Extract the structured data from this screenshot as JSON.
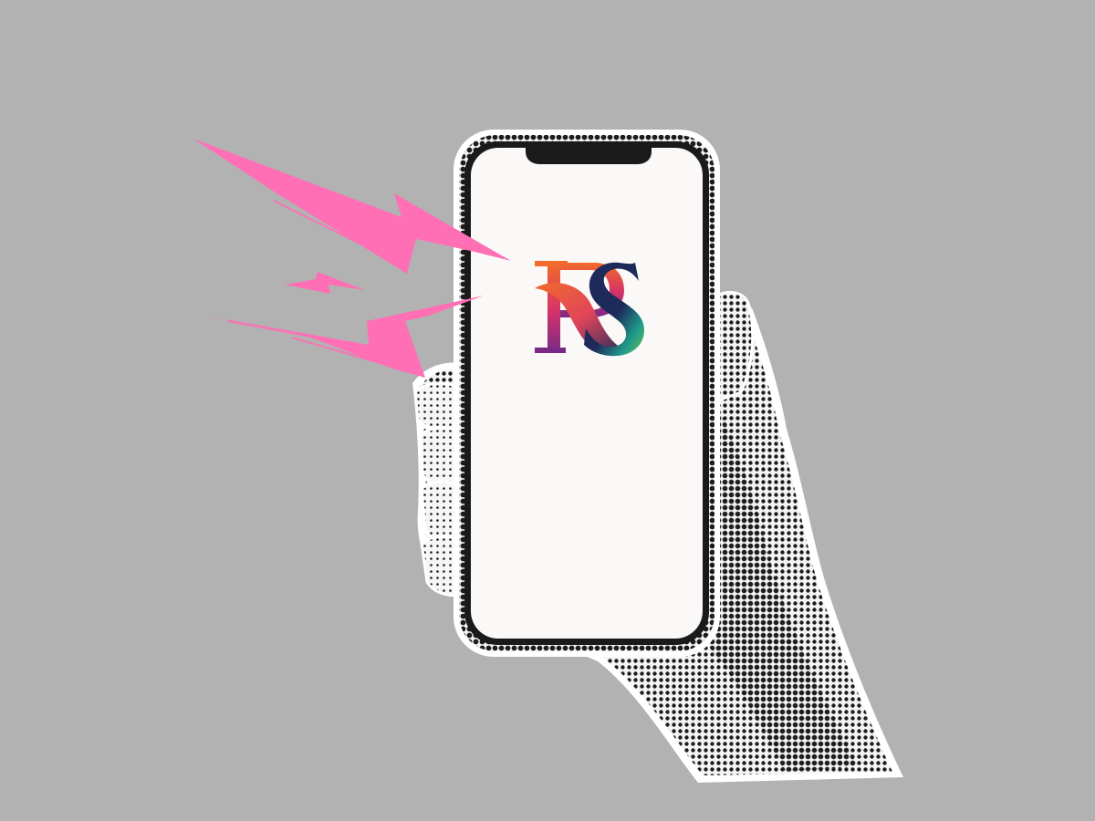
{
  "scene": {
    "background_color": "#b2b2b2",
    "description_icons": [
      "hand-icon",
      "smartphone-icon",
      "lightning-bolt-icon"
    ]
  },
  "logo": {
    "text": "RS",
    "colors": {
      "orange": "#f26b2a",
      "magenta": "#d4326a",
      "purple": "#7a2a86",
      "navy": "#1d2a5a",
      "teal": "#1f9a8c",
      "green": "#6cbf4a"
    }
  },
  "phone": {
    "frame_color": "#1a1a1a",
    "screen_color": "#fbf9f7"
  },
  "bolts": {
    "color": "#ff6fb5"
  }
}
